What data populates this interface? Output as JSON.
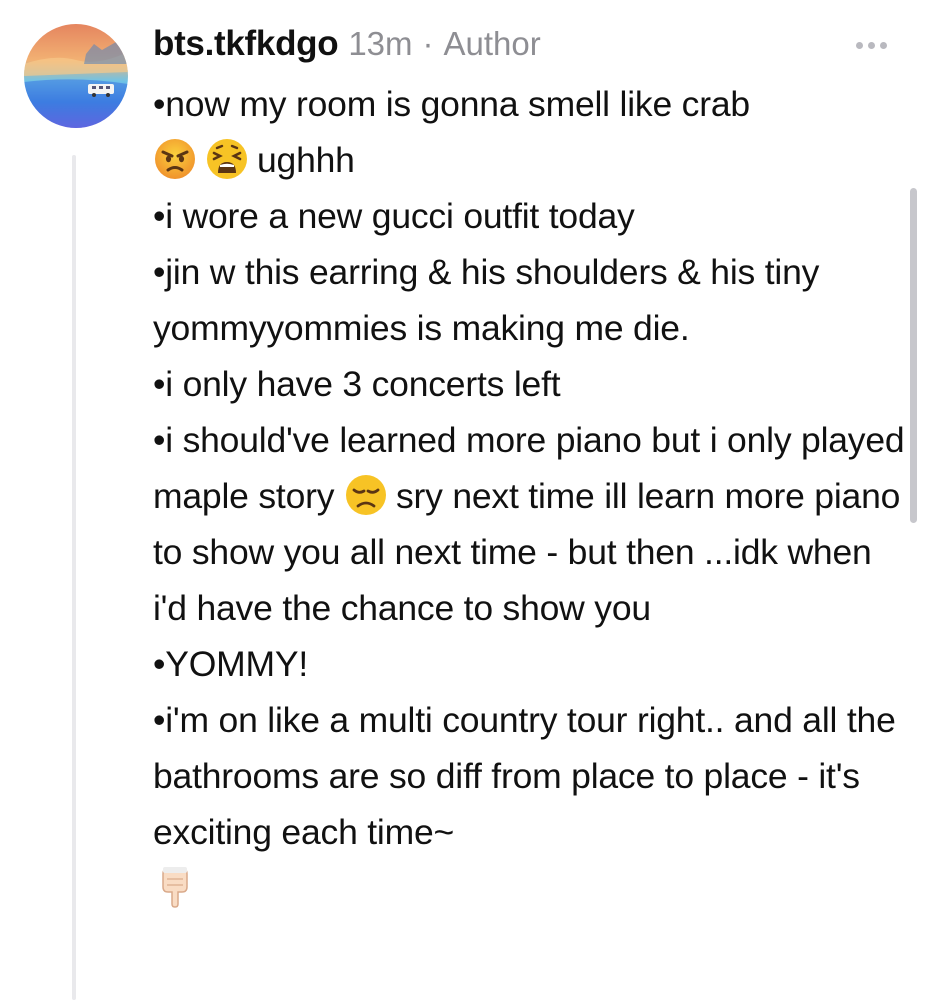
{
  "post": {
    "username": "bts.tkfkdgo",
    "time": "13m",
    "separator": "·",
    "role": "Author"
  },
  "icons": {
    "avatar": "avatar-sky-ocean-rv",
    "more": "more-options-icon",
    "angry": "angry-face-emoji",
    "weary": "weary-face-emoji",
    "disappointed": "disappointed-face-emoji",
    "pointing": "backhand-index-pointing-down-emoji"
  },
  "paragraphs": {
    "p1_text1": "•now my room is gonna smell like crab",
    "p1_text2": "ughhh",
    "p2": "•i wore a new gucci outfit today",
    "p3": "•jin w this earring & his shoulders & his tiny yommyyommies is making me die.",
    "p4": "•i only have 3 concerts left",
    "p5_text1": "•i should've learned more piano but i only played maple story",
    "p5_text2": "sry next time ill learn more piano to show you all next time - but then ...idk when i'd have the chance to show you",
    "p6": "•YOMMY!",
    "p7": "•i'm on like a multi country tour right.. and all the bathrooms are so diff from place to place - it's exciting each time~"
  },
  "colors": {
    "text": "#111111",
    "meta": "#8e8e93",
    "thread_line": "#e9e9ec",
    "emoji_yellow": "#f7c325",
    "angry_orange": "#f29a2e"
  }
}
